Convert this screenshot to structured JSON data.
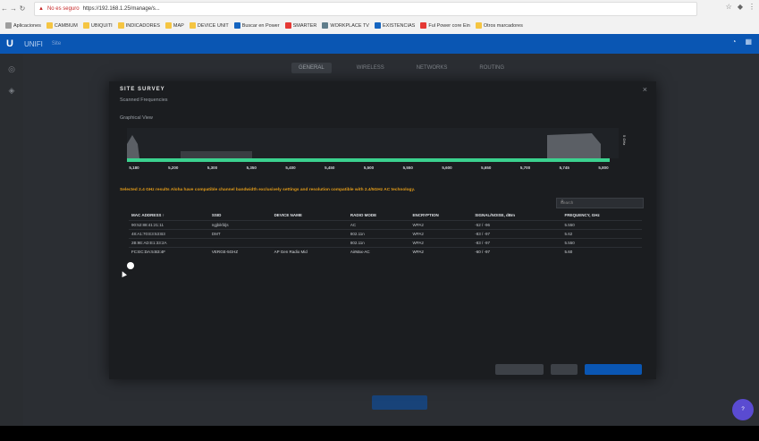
{
  "browser": {
    "address_warning": "No es seguro",
    "url": "https://192.168.1.25/manage/s..."
  },
  "bookmarks": [
    {
      "label": "Aplicaciones",
      "color": "#9e9e9e"
    },
    {
      "label": "CAMBIUM",
      "color": "#f5c542"
    },
    {
      "label": "UBIQUITI",
      "color": "#f5c542"
    },
    {
      "label": "INDICADORES",
      "color": "#f5c542"
    },
    {
      "label": "MAP",
      "color": "#f5c542"
    },
    {
      "label": "DEVICE UNIT",
      "color": "#f5c542"
    },
    {
      "label": "Buscar en Power",
      "color": "#1565c0"
    },
    {
      "label": "SMARTER",
      "color": "#e53935"
    },
    {
      "label": "WORKPLACE TV",
      "color": "#607d8b"
    },
    {
      "label": "EXISTENCIAS",
      "color": "#1565c0"
    },
    {
      "label": "Ful Power core Ein",
      "color": "#e53935"
    },
    {
      "label": "Otros marcadores",
      "color": "#f5c542"
    }
  ],
  "app": {
    "logo": "U",
    "name": "UNIFI",
    "subtitle": "Site"
  },
  "bg_tabs": [
    "GENERAL",
    "WIRELESS",
    "NETWORKS",
    "ROUTING"
  ],
  "modal": {
    "title": "SITE SURVEY",
    "freq_label": "Scanned Frequencies",
    "graph_label": "Graphical View",
    "warning": "Selected 2.4 GHz results Aloha have compatible channel bandwidth exclusively settings and resolution compatible with 2.4/5GHz AC technology.",
    "search_placeholder": "Search",
    "ticks": [
      "5,180",
      "5,200",
      "5,300",
      "5,350",
      "5,400",
      "5,450",
      "5,500",
      "5,550",
      "5,600",
      "5,650",
      "5,700",
      "5,745",
      "5,800"
    ],
    "legend": "5 GHz",
    "table": {
      "headers": [
        "MAC ADDRESS ↑",
        "SSID",
        "DEVICE NAME",
        "RADIO MODE",
        "ENCRYPTION",
        "SIGNAL/NOISE, dBm",
        "FREQUENCY, GHz"
      ],
      "rows": [
        [
          "90:52:88:41:21:11",
          "ngjbikfdjs",
          "",
          "AC",
          "WPA2",
          "-52 / -96",
          "5.550"
        ],
        [
          "48:A1:70:E3:53:B3",
          "DMT",
          "",
          "802.11n",
          "WPA2",
          "-83 / -97",
          "5.62"
        ],
        [
          "2B:9E:AD:E1:33:2A",
          "",
          "",
          "802.11n",
          "WPA2",
          "-83 / -97",
          "5.550"
        ],
        [
          "FC:EC:DA:5:B3:4F",
          "VERGE-5GHZ",
          "AP Gen Radio Mid",
          "AirMax-AC",
          "WPA2",
          "-60 / -97",
          "5.60"
        ]
      ]
    }
  }
}
